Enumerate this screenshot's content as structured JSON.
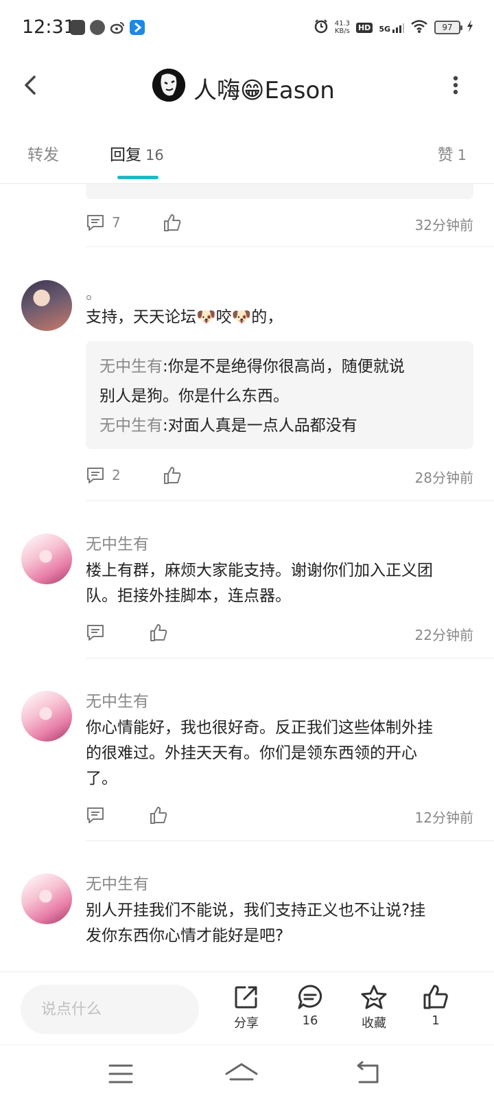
{
  "status_bar": {
    "time": "12:31",
    "net_speed_value": "41.3",
    "net_speed_unit": "KB/s",
    "hd": "HD",
    "network": "5G",
    "battery": "97",
    "app_icons": [
      "youku-app-icon",
      "speedometer-app-icon",
      "weibo-app-icon",
      "blue-app-icon"
    ]
  },
  "header": {
    "title": "人嗨😁Eason"
  },
  "tabs": {
    "forward": "转发",
    "reply": "回复",
    "reply_count": "16",
    "like": "赞",
    "like_count": "1"
  },
  "replies": [
    {
      "comment_count": "7",
      "time": "32分钟前"
    },
    {
      "author": "。",
      "text": "支持，天天论坛🐶咬🐶的，",
      "quotes": [
        {
          "user": "无中生有",
          "sep": ":",
          "text": "你是不是绝得你很高尚，随便就说",
          "text_cont": "别人是狗。你是什么东西。"
        },
        {
          "user": "无中生有",
          "sep": ":",
          "text": "对面人真是一点人品都没有"
        }
      ],
      "comment_count": "2",
      "time": "28分钟前"
    },
    {
      "author": "无中生有",
      "text_line1": "楼上有群，麻烦大家能支持。谢谢你们加入正义团",
      "text_line2": "队。拒接外挂脚本，连点器。",
      "time": "22分钟前"
    },
    {
      "author": "无中生有",
      "text_line1": "你心情能好，我也很好奇。反正我们这些体制外挂",
      "text_line2": "的很难过。外挂天天有。你们是领东西领的开心",
      "text_line3": "了。",
      "time": "12分钟前"
    },
    {
      "author": "无中生有",
      "text_line1": "别人开挂我们不能说，我们支持正义也不让说?挂",
      "text_line2": "发你东西你心情才能好是吧?"
    }
  ],
  "bottom_bar": {
    "input_placeholder": "说点什么",
    "share_label": "分享",
    "comment_count": "16",
    "favorite_label": "收藏",
    "like_count": "1"
  },
  "colors": {
    "accent": "#21b7c7",
    "muted_text": "#888888",
    "quote_bg": "#f5f5f5"
  }
}
